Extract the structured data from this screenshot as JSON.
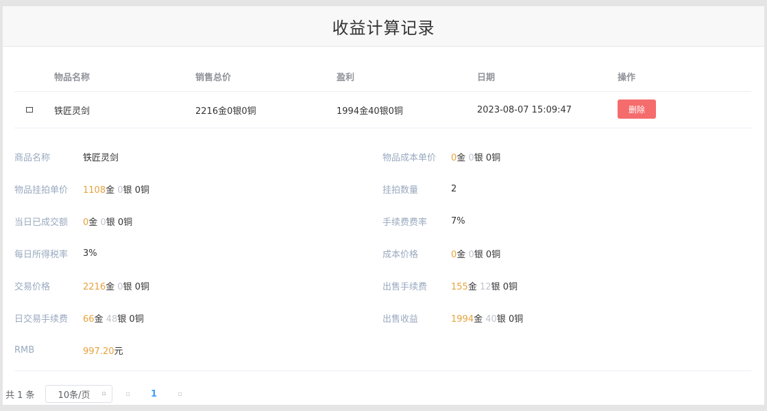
{
  "header": {
    "title": "收益计算记录"
  },
  "table": {
    "columns": [
      "物品名称",
      "销售总价",
      "盈利",
      "日期",
      "操作"
    ],
    "rows": [
      {
        "expand_icon": "▫",
        "name": "铁匠灵剑",
        "total_price": "2216金0银0铜",
        "profit": "1994金40银0铜",
        "date": "2023-08-07 15:09:47",
        "delete_label": "删除"
      }
    ]
  },
  "details": {
    "left": [
      {
        "label": "商品名称",
        "text": "铁匠灵剑"
      },
      {
        "label": "物品挂拍单价",
        "gold": "1108",
        "silver": "0",
        "copper": "0"
      },
      {
        "label": "当日已成交额",
        "gold": "0",
        "silver": "0",
        "copper": "0"
      },
      {
        "label": "每日所得税率",
        "text": "3%"
      },
      {
        "label": "交易价格",
        "gold": "2216",
        "silver": "0",
        "copper": "0"
      },
      {
        "label": "日交易手续费",
        "gold": "66",
        "silver": "48",
        "copper": "0"
      },
      {
        "label": "RMB",
        "rmb": "997.20",
        "rmb_unit": "元"
      }
    ],
    "right": [
      {
        "label": "物品成本单价",
        "gold": "0",
        "silver": "0",
        "copper": "0"
      },
      {
        "label": "挂拍数量",
        "text": "2"
      },
      {
        "label": "手续费费率",
        "text": "7%"
      },
      {
        "label": "成本价格",
        "gold": "0",
        "silver": "0",
        "copper": "0"
      },
      {
        "label": "出售手续费",
        "gold": "155",
        "silver": "12",
        "copper": "0"
      },
      {
        "label": "出售收益",
        "gold": "1994",
        "silver": "40",
        "copper": "0"
      }
    ],
    "units": {
      "gold": "金",
      "silver": "银",
      "copper": "铜"
    }
  },
  "pagination": {
    "total": "共 1 条",
    "page_size": "10条/页",
    "page_size_arrow": "▫",
    "prev": "▫",
    "current": "1",
    "next": "▫"
  },
  "colors": {
    "gold": "#e6a23c",
    "silver": "#c0c4cc",
    "danger": "#f56c6c",
    "primary": "#409eff"
  }
}
